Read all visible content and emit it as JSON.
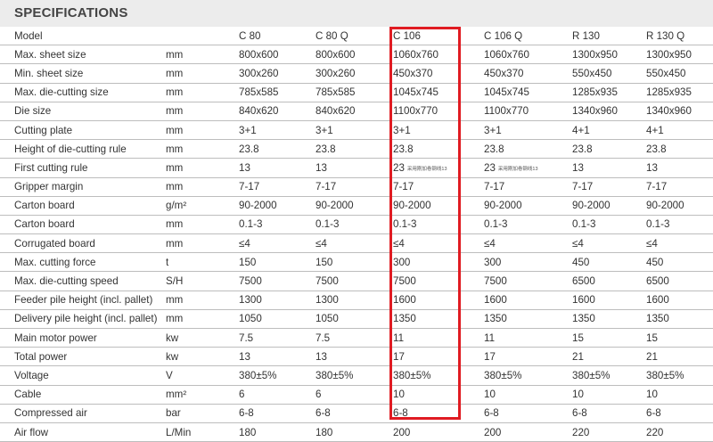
{
  "title": "SPECIFICATIONS",
  "header": {
    "param": "Model",
    "unit": "",
    "models": [
      "C 80",
      "C 80 Q",
      "C 106",
      "C 106 Q",
      "R 130",
      "R 130 Q"
    ]
  },
  "rows": [
    {
      "param": "Max. sheet size",
      "unit": "mm",
      "values": [
        "800x600",
        "800x600",
        "1060x760",
        "1060x760",
        "1300x950",
        "1300x950"
      ]
    },
    {
      "param": "Min. sheet size",
      "unit": "mm",
      "values": [
        "300x260",
        "300x260",
        "450x370",
        "450x370",
        "550x450",
        "550x450"
      ]
    },
    {
      "param": "Max. die-cutting size",
      "unit": "mm",
      "values": [
        "785x585",
        "785x585",
        "1045x745",
        "1045x745",
        "1285x935",
        "1285x935"
      ]
    },
    {
      "param": "Die size",
      "unit": "mm",
      "values": [
        "840x620",
        "840x620",
        "1100x770",
        "1100x770",
        "1340x960",
        "1340x960"
      ]
    },
    {
      "param": "Cutting plate",
      "unit": "mm",
      "values": [
        "3+1",
        "3+1",
        "3+1",
        "3+1",
        "4+1",
        "4+1"
      ]
    },
    {
      "param": "Height of die-cutting rule",
      "unit": "mm",
      "values": [
        "23.8",
        "23.8",
        "23.8",
        "23.8",
        "23.8",
        "23.8"
      ]
    },
    {
      "param": "First cutting rule",
      "unit": "mm",
      "values": [
        "13",
        "13",
        "23",
        "23",
        "13",
        "13"
      ],
      "notes": [
        "",
        "",
        "采用刚加卷钢线13",
        "采用刚加卷钢线13",
        "",
        ""
      ]
    },
    {
      "param": "Gripper margin",
      "unit": "mm",
      "values": [
        "7-17",
        "7-17",
        "7-17",
        "7-17",
        "7-17",
        "7-17"
      ]
    },
    {
      "param": "Carton board",
      "unit": "g/m²",
      "values": [
        "90-2000",
        "90-2000",
        "90-2000",
        "90-2000",
        "90-2000",
        "90-2000"
      ]
    },
    {
      "param": "Carton board",
      "unit": "mm",
      "values": [
        "0.1-3",
        "0.1-3",
        "0.1-3",
        "0.1-3",
        "0.1-3",
        "0.1-3"
      ]
    },
    {
      "param": "Corrugated board",
      "unit": "mm",
      "values": [
        "≤4",
        "≤4",
        "≤4",
        "≤4",
        "≤4",
        "≤4"
      ]
    },
    {
      "param": "Max. cutting force",
      "unit": "t",
      "values": [
        "150",
        "150",
        "300",
        "300",
        "450",
        "450"
      ]
    },
    {
      "param": "Max. die-cutting speed",
      "unit": "S/H",
      "values": [
        "7500",
        "7500",
        "7500",
        "7500",
        "6500",
        "6500"
      ]
    },
    {
      "param": "Feeder pile height (incl. pallet)",
      "unit": "mm",
      "values": [
        "1300",
        "1300",
        "1600",
        "1600",
        "1600",
        "1600"
      ]
    },
    {
      "param": "Delivery pile height (incl. pallet)",
      "unit": "mm",
      "values": [
        "1050",
        "1050",
        "1350",
        "1350",
        "1350",
        "1350"
      ]
    },
    {
      "param": "Main motor power",
      "unit": "kw",
      "values": [
        "7.5",
        "7.5",
        "11",
        "11",
        "15",
        "15"
      ]
    },
    {
      "param": "Total power",
      "unit": "kw",
      "values": [
        "13",
        "13",
        "17",
        "17",
        "21",
        "21"
      ]
    },
    {
      "param": "Voltage",
      "unit": "V",
      "values": [
        "380±5%",
        "380±5%",
        "380±5%",
        "380±5%",
        "380±5%",
        "380±5%"
      ]
    },
    {
      "param": "Cable",
      "unit": "mm²",
      "values": [
        "6",
        "6",
        "10",
        "10",
        "10",
        "10"
      ]
    },
    {
      "param": "Compressed air",
      "unit": "bar",
      "values": [
        "6-8",
        "6-8",
        "6-8",
        "6-8",
        "6-8",
        "6-8"
      ]
    },
    {
      "param": "Air flow",
      "unit": "L/Min",
      "values": [
        "180",
        "180",
        "200",
        "200",
        "220",
        "220"
      ]
    }
  ],
  "highlight": {
    "model": "C 106",
    "color": "#e01b22"
  }
}
